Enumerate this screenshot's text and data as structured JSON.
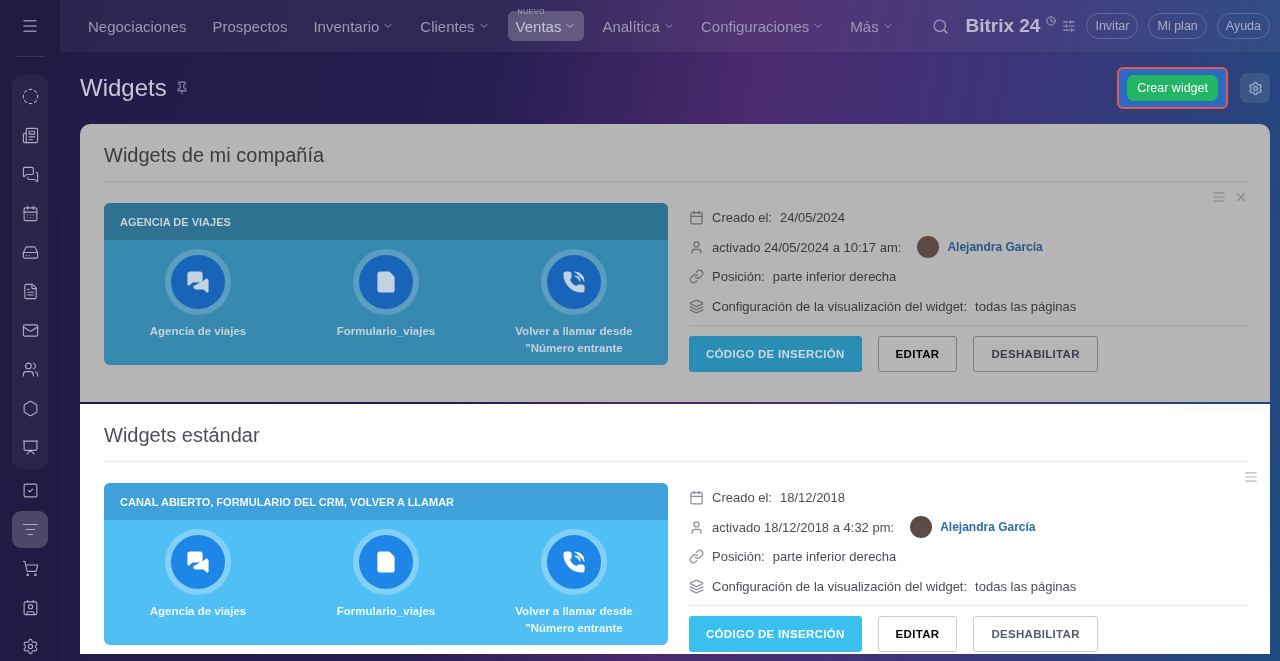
{
  "sidebar": {
    "pinned_items": [
      {
        "kind": "sites",
        "selected": false
      },
      {
        "kind": "feed",
        "selected": false
      },
      {
        "kind": "chat",
        "selected": false
      },
      {
        "kind": "calendar",
        "selected": false
      },
      {
        "kind": "drive",
        "selected": false
      },
      {
        "kind": "document",
        "selected": false
      },
      {
        "kind": "mail",
        "selected": false
      },
      {
        "kind": "contacts",
        "selected": false
      },
      {
        "kind": "hexagon",
        "selected": false
      },
      {
        "kind": "presentation",
        "selected": false
      }
    ],
    "items": [
      {
        "kind": "tasks",
        "selected": false
      },
      {
        "kind": "funnel",
        "selected": true
      },
      {
        "kind": "cart",
        "selected": false
      },
      {
        "kind": "card",
        "selected": false
      },
      {
        "kind": "settings",
        "selected": false
      }
    ]
  },
  "topbar": {
    "nav": [
      {
        "label": "Negociaciones",
        "dropdown": false,
        "selected": false
      },
      {
        "label": "Prospectos",
        "dropdown": false,
        "selected": false
      },
      {
        "label": "Inventario",
        "dropdown": true,
        "selected": false
      },
      {
        "label": "Clientes",
        "dropdown": true,
        "selected": false
      },
      {
        "label": "Ventas",
        "dropdown": true,
        "selected": true,
        "badge": "NUEVO"
      },
      {
        "label": "Analítica",
        "dropdown": true,
        "selected": false
      },
      {
        "label": "Configuraciones",
        "dropdown": true,
        "selected": false
      },
      {
        "label": "Más",
        "dropdown": true,
        "selected": false
      }
    ],
    "logo": "Bitrix 24",
    "buttons": [
      "Invitar",
      "Mi plan",
      "Ayuda"
    ]
  },
  "page": {
    "title": "Widgets",
    "create_button": "Crear widget",
    "highlighted": true
  },
  "sections": [
    {
      "title": "Widgets de mi compañía",
      "dimmed": true,
      "closable": true,
      "widget": {
        "header": "AGENCIA DE VIAJES",
        "channels": [
          {
            "kind": "chat",
            "label": "Agencia de viajes"
          },
          {
            "kind": "form",
            "label": "Formulario_viajes"
          },
          {
            "kind": "call",
            "label": "Volver a llamar desde \"Número entrante"
          }
        ]
      },
      "details": [
        {
          "kind": "created",
          "label": "Creado el:",
          "value": "24/05/2024"
        },
        {
          "kind": "activated",
          "label": "activado 24/05/2024 a 10:17 am:",
          "user": "Alejandra García"
        },
        {
          "kind": "position",
          "label": "Posición:",
          "value": "parte inferior derecha"
        },
        {
          "kind": "display",
          "label": "Configuración de la visualización del widget:",
          "value": "todas las páginas"
        }
      ],
      "buttons": [
        {
          "label": "CÓDIGO DE INSERCIÓN",
          "primary": true
        },
        {
          "label": "EDITAR",
          "primary": false
        },
        {
          "label": "DESHABILITAR",
          "primary": false
        }
      ]
    },
    {
      "title": "Widgets estándar",
      "dimmed": false,
      "closable": false,
      "widget": {
        "header": "CANAL ABIERTO, FORMULARIO DEL CRM, VOLVER A LLAMAR",
        "channels": [
          {
            "kind": "chat",
            "label": "Agencia de viajes"
          },
          {
            "kind": "form",
            "label": "Formulario_viajes"
          },
          {
            "kind": "call",
            "label": "Volver a llamar desde \"Número entrante"
          }
        ]
      },
      "details": [
        {
          "kind": "created",
          "label": "Creado el:",
          "value": "18/12/2018"
        },
        {
          "kind": "activated",
          "label": "activado 18/12/2018 a 4:32 pm:",
          "user": "Alejandra García"
        },
        {
          "kind": "position",
          "label": "Posición:",
          "value": "parte inferior derecha"
        },
        {
          "kind": "display",
          "label": "Configuración de la visualización del widget:",
          "value": "todas las páginas"
        }
      ],
      "buttons": [
        {
          "label": "CÓDIGO DE INSERCIÓN",
          "primary": true
        },
        {
          "label": "EDITAR",
          "primary": false
        },
        {
          "label": "DESHABILITAR",
          "primary": false
        }
      ]
    }
  ]
}
